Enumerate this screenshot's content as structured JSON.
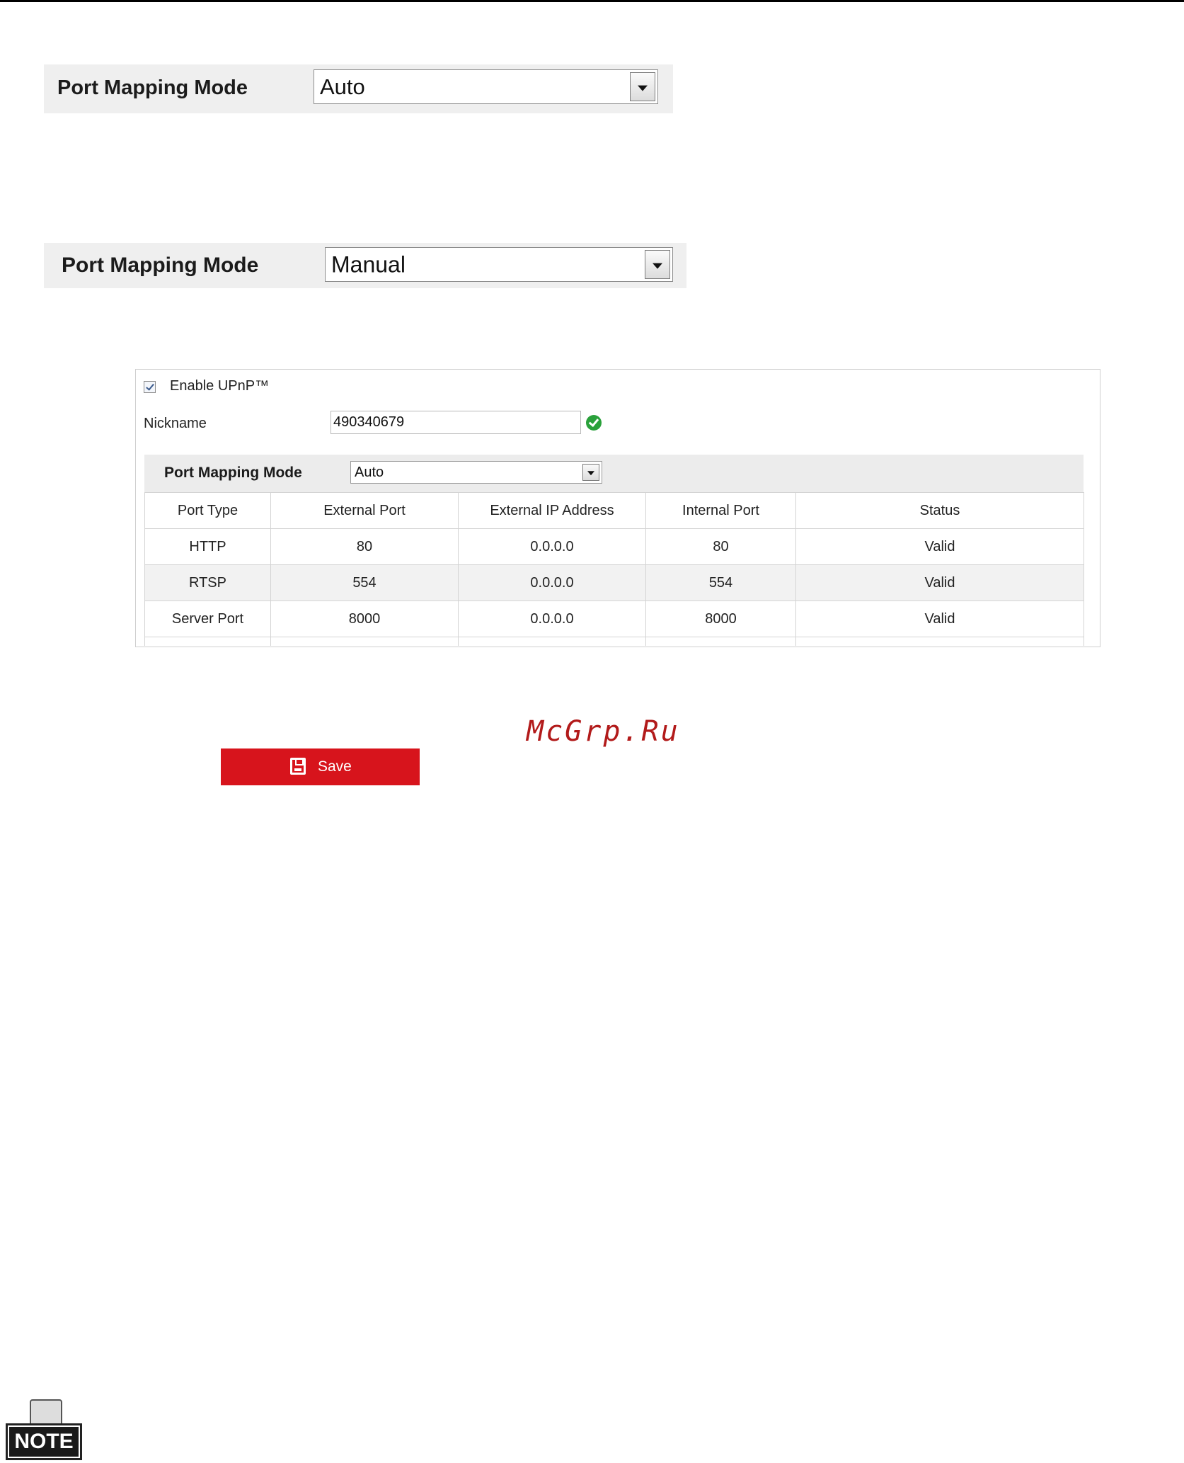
{
  "pm_auto": {
    "label": "Port Mapping Mode",
    "value": "Auto"
  },
  "pm_manual": {
    "label": "Port Mapping Mode",
    "value": "Manual"
  },
  "upnp": {
    "enable_label": "Enable UPnP™",
    "enabled": true,
    "nickname_label": "Nickname",
    "nickname_value": "490340679",
    "mode_label": "Port Mapping Mode",
    "mode_value": "Auto",
    "columns": [
      "Port Type",
      "External Port",
      "External IP Address",
      "Internal Port",
      "Status"
    ],
    "rows": [
      [
        "HTTP",
        "80",
        "0.0.0.0",
        "80",
        "Valid"
      ],
      [
        "RTSP",
        "554",
        "0.0.0.0",
        "554",
        "Valid"
      ],
      [
        "Server Port",
        "8000",
        "0.0.0.0",
        "8000",
        "Valid"
      ]
    ]
  },
  "watermark": "McGrp.Ru",
  "save_label": "Save",
  "note_label": "NOTE",
  "colors": {
    "save_button": "#d7141c",
    "valid_icon": "#2aa13b",
    "row_band": "#efefef"
  }
}
